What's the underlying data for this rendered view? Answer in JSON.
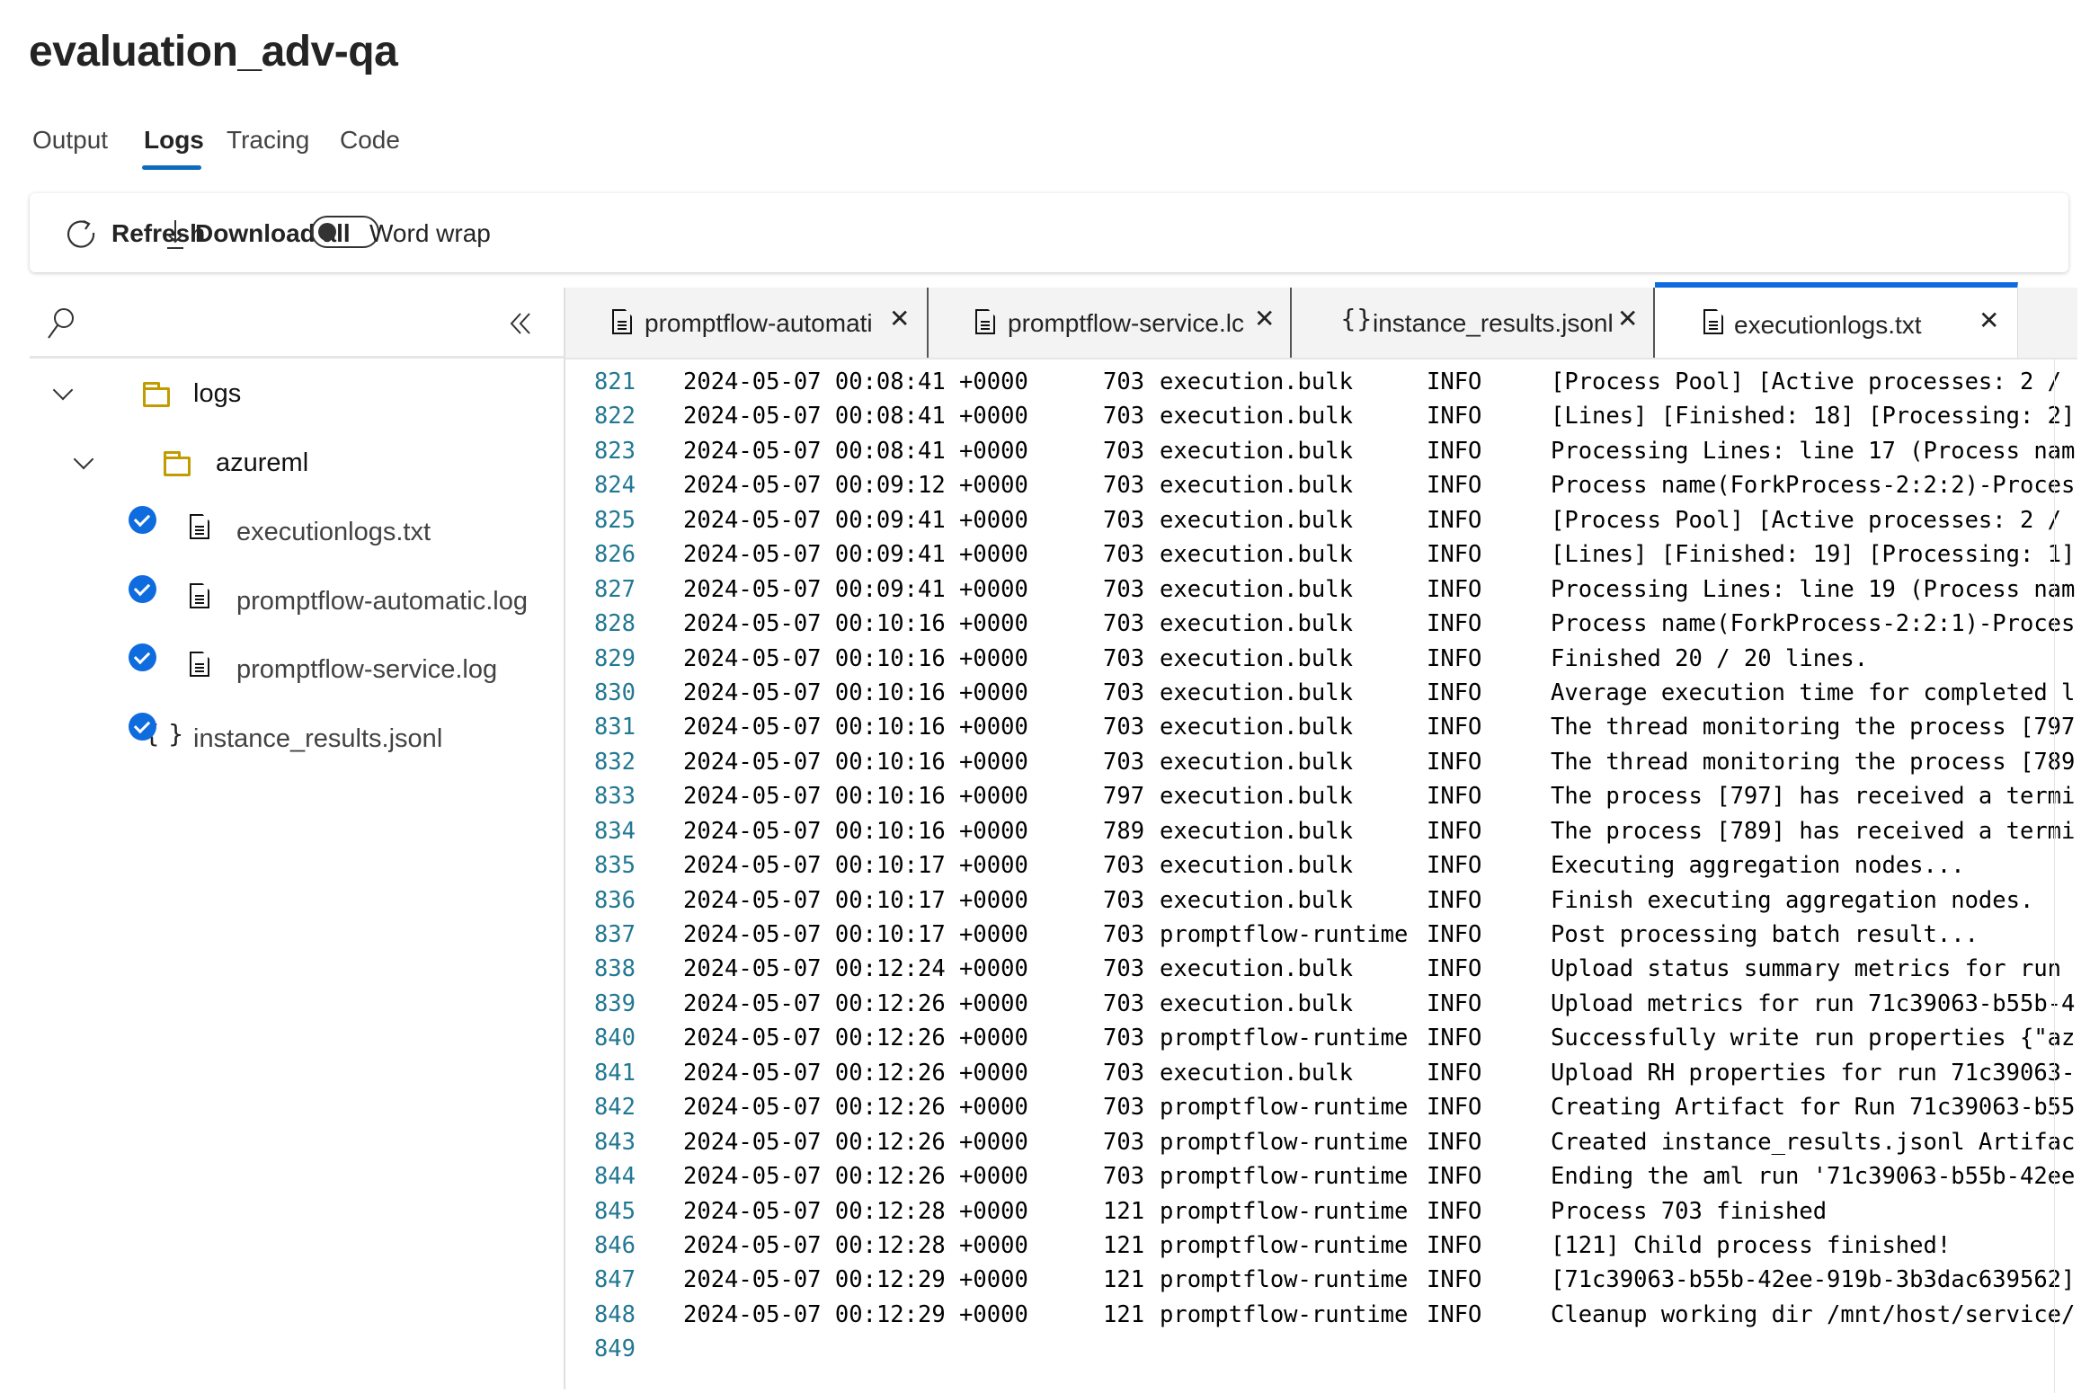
{
  "title": "evaluation_adv-qa",
  "page_tabs": [
    {
      "label": "Output",
      "active": false
    },
    {
      "label": "Logs",
      "active": true
    },
    {
      "label": "Tracing",
      "active": false
    },
    {
      "label": "Code",
      "active": false
    }
  ],
  "toolbar": {
    "refresh": "Refresh",
    "download_all": "Download all",
    "word_wrap": "Word wrap",
    "word_wrap_on": false
  },
  "tree": {
    "folders": [
      {
        "label": "logs",
        "icon": "folder-icon"
      },
      {
        "label": "azureml",
        "icon": "folder-icon"
      }
    ],
    "files": [
      {
        "label": "executionlogs.txt",
        "icon": "file-icon",
        "checked": true
      },
      {
        "label": "promptflow-automatic.log",
        "icon": "file-icon",
        "checked": true
      },
      {
        "label": "promptflow-service.log",
        "icon": "file-icon",
        "checked": true
      },
      {
        "label": "instance_results.jsonl",
        "icon": "braces-icon",
        "checked": true
      }
    ]
  },
  "editor_tabs": [
    {
      "label": "promptflow-automati",
      "icon": "file-icon",
      "active": false
    },
    {
      "label": "promptflow-service.lc",
      "icon": "file-icon",
      "active": false
    },
    {
      "label": "instance_results.jsonl",
      "icon": "braces-icon",
      "active": false
    },
    {
      "label": "executionlogs.txt",
      "icon": "file-icon",
      "active": true
    }
  ],
  "colors": {
    "accent": "#0f6cbd",
    "line_number": "#237893",
    "folder": "#c19c00"
  },
  "log_lines": [
    [
      "821",
      "2024-05-07 00:08:41 +0000",
      "703",
      "execution.bulk",
      "INFO",
      "[Process Pool] [Active processes: 2 /"
    ],
    [
      "822",
      "2024-05-07 00:08:41 +0000",
      "703",
      "execution.bulk",
      "INFO",
      "[Lines] [Finished: 18] [Processing: 2]"
    ],
    [
      "823",
      "2024-05-07 00:08:41 +0000",
      "703",
      "execution.bulk",
      "INFO",
      "Processing Lines: line 17 (Process nam"
    ],
    [
      "824",
      "2024-05-07 00:09:12 +0000",
      "703",
      "execution.bulk",
      "INFO",
      "Process name(ForkProcess-2:2:2)-Proces"
    ],
    [
      "825",
      "2024-05-07 00:09:41 +0000",
      "703",
      "execution.bulk",
      "INFO",
      "[Process Pool] [Active processes: 2 /"
    ],
    [
      "826",
      "2024-05-07 00:09:41 +0000",
      "703",
      "execution.bulk",
      "INFO",
      "[Lines] [Finished: 19] [Processing: 1]"
    ],
    [
      "827",
      "2024-05-07 00:09:41 +0000",
      "703",
      "execution.bulk",
      "INFO",
      "Processing Lines: line 19 (Process nam"
    ],
    [
      "828",
      "2024-05-07 00:10:16 +0000",
      "703",
      "execution.bulk",
      "INFO",
      "Process name(ForkProcess-2:2:1)-Proces"
    ],
    [
      "829",
      "2024-05-07 00:10:16 +0000",
      "703",
      "execution.bulk",
      "INFO",
      "Finished 20 / 20 lines."
    ],
    [
      "830",
      "2024-05-07 00:10:16 +0000",
      "703",
      "execution.bulk",
      "INFO",
      "Average execution time for completed l"
    ],
    [
      "831",
      "2024-05-07 00:10:16 +0000",
      "703",
      "execution.bulk",
      "INFO",
      "The thread monitoring the process [797"
    ],
    [
      "832",
      "2024-05-07 00:10:16 +0000",
      "703",
      "execution.bulk",
      "INFO",
      "The thread monitoring the process [789"
    ],
    [
      "833",
      "2024-05-07 00:10:16 +0000",
      "797",
      "execution.bulk",
      "INFO",
      "The process [797] has received a termi"
    ],
    [
      "834",
      "2024-05-07 00:10:16 +0000",
      "789",
      "execution.bulk",
      "INFO",
      "The process [789] has received a termi"
    ],
    [
      "835",
      "2024-05-07 00:10:17 +0000",
      "703",
      "execution.bulk",
      "INFO",
      "Executing aggregation nodes..."
    ],
    [
      "836",
      "2024-05-07 00:10:17 +0000",
      "703",
      "execution.bulk",
      "INFO",
      "Finish executing aggregation nodes."
    ],
    [
      "837",
      "2024-05-07 00:10:17 +0000",
      "703",
      "promptflow-runtime",
      "INFO",
      "Post processing batch result..."
    ],
    [
      "838",
      "2024-05-07 00:12:24 +0000",
      "703",
      "execution.bulk",
      "INFO",
      "Upload status summary metrics for run"
    ],
    [
      "839",
      "2024-05-07 00:12:26 +0000",
      "703",
      "execution.bulk",
      "INFO",
      "Upload metrics for run 71c39063-b55b-4"
    ],
    [
      "840",
      "2024-05-07 00:12:26 +0000",
      "703",
      "promptflow-runtime",
      "INFO",
      "Successfully write run properties {\"az"
    ],
    [
      "841",
      "2024-05-07 00:12:26 +0000",
      "703",
      "execution.bulk",
      "INFO",
      "Upload RH properties for run 71c39063-"
    ],
    [
      "842",
      "2024-05-07 00:12:26 +0000",
      "703",
      "promptflow-runtime",
      "INFO",
      "Creating Artifact for Run 71c39063-b55"
    ],
    [
      "843",
      "2024-05-07 00:12:26 +0000",
      "703",
      "promptflow-runtime",
      "INFO",
      "Created instance_results.jsonl Artifac"
    ],
    [
      "844",
      "2024-05-07 00:12:26 +0000",
      "703",
      "promptflow-runtime",
      "INFO",
      "Ending the aml run '71c39063-b55b-42ee"
    ],
    [
      "845",
      "2024-05-07 00:12:28 +0000",
      "121",
      "promptflow-runtime",
      "INFO",
      "Process 703 finished"
    ],
    [
      "846",
      "2024-05-07 00:12:28 +0000",
      "121",
      "promptflow-runtime",
      "INFO",
      "[121] Child process finished!"
    ],
    [
      "847",
      "2024-05-07 00:12:29 +0000",
      "121",
      "promptflow-runtime",
      "INFO",
      "[71c39063-b55b-42ee-919b-3b3dac639562]"
    ],
    [
      "848",
      "2024-05-07 00:12:29 +0000",
      "121",
      "promptflow-runtime",
      "INFO",
      "Cleanup working dir /mnt/host/service/"
    ],
    [
      "849",
      "",
      "",
      "",
      "",
      ""
    ]
  ]
}
